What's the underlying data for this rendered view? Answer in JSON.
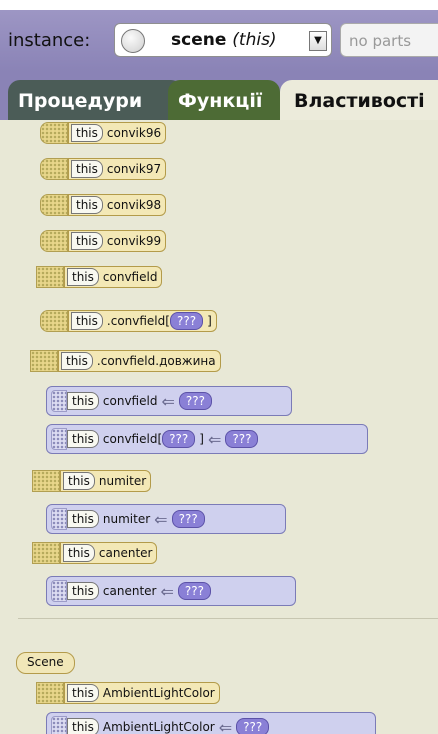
{
  "header": {
    "instance_label": "instance:",
    "instance_name": "scene",
    "instance_suffix": "(this)",
    "parts_placeholder": "no parts"
  },
  "tabs": [
    {
      "label": "Процедури"
    },
    {
      "label": "Функції"
    },
    {
      "label": "Властивості"
    }
  ],
  "rows": [
    {
      "this": "this",
      "name": "convik96"
    },
    {
      "this": "this",
      "name": "convik97"
    },
    {
      "this": "this",
      "name": "convik98"
    },
    {
      "this": "this",
      "name": "convik99"
    },
    {
      "this": "this",
      "name": "convfield"
    },
    {
      "this": "this",
      "name": ".convfield[",
      "placeholder": "???",
      "tail": "]"
    },
    {
      "this": "this",
      "name": ".convfield",
      "tail": ".довжина"
    },
    {
      "this": "this",
      "name": "convfield",
      "placeholder": "???"
    },
    {
      "this": "this",
      "name": "convfield[",
      "placeholder": "???",
      "tail": "]",
      "rhs": "???"
    },
    {
      "this": "this",
      "name": "numiter"
    },
    {
      "this": "this",
      "name": "numiter",
      "placeholder": "???"
    },
    {
      "this": "this",
      "name": "canenter"
    },
    {
      "this": "this",
      "name": "canenter",
      "placeholder": "???"
    }
  ],
  "scene_tag": "Scene",
  "scene_rows": [
    {
      "this": "this",
      "name": "AmbientLightColor"
    },
    {
      "this": "this",
      "name": "AmbientLightColor",
      "placeholder": "???"
    }
  ]
}
